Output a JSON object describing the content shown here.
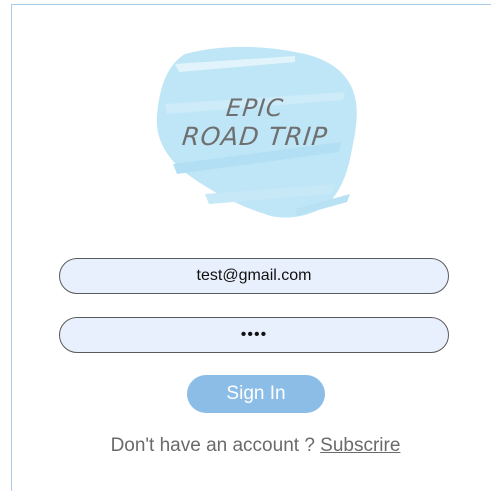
{
  "logo": {
    "line1": "EPIC",
    "line2": "ROAD TRIP",
    "splash_color": "#bfe6f6"
  },
  "login": {
    "email_value": "test@gmail.com",
    "password_mask": "••••"
  },
  "signin": {
    "label": "Sign In",
    "color": "#8cbde6"
  },
  "footer": {
    "prompt": "Don't have an account ? ",
    "link_label": "Subscrire"
  }
}
